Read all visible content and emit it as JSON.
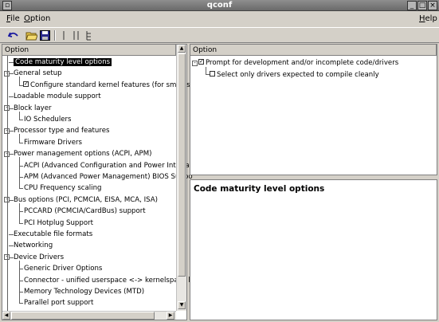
{
  "window": {
    "title": "qconf"
  },
  "menu": {
    "file": "ile",
    "file_u": "F",
    "option": "ption",
    "option_u": "O",
    "help": "elp",
    "help_u": "H"
  },
  "toolbar": {
    "tools": [
      {
        "icon": "undo-icon"
      },
      {
        "icon": "open-folder-icon"
      },
      {
        "icon": "save-icon"
      },
      {
        "icon": "single-view-icon"
      },
      {
        "icon": "split-view-icon"
      },
      {
        "icon": "full-view-icon"
      }
    ]
  },
  "left_panel": {
    "header": "Option",
    "items": [
      {
        "label": "Code maturity level options",
        "selected": true
      },
      {
        "label": "General setup",
        "expander": "-"
      },
      {
        "label": "Configure standard kernel features (for small sys",
        "checkbox": true
      },
      {
        "label": "Loadable module support"
      },
      {
        "label": "Block layer",
        "expander": "-"
      },
      {
        "label": "IO Schedulers"
      },
      {
        "label": "Processor type and features",
        "expander": "-"
      },
      {
        "label": "Firmware Drivers"
      },
      {
        "label": "Power management options (ACPI, APM)",
        "expander": "-"
      },
      {
        "label": "ACPI (Advanced Configuration and Power Interface"
      },
      {
        "label": "APM (Advanced Power Management) BIOS Suppo"
      },
      {
        "label": "CPU Frequency scaling"
      },
      {
        "label": "Bus options (PCI, PCMCIA, EISA, MCA, ISA)",
        "expander": "-"
      },
      {
        "label": "PCCARD (PCMCIA/CardBus) support"
      },
      {
        "label": "PCI Hotplug Support"
      },
      {
        "label": "Executable file formats"
      },
      {
        "label": "Networking"
      },
      {
        "label": "Device Drivers",
        "expander": "-"
      },
      {
        "label": "Generic Driver Options"
      },
      {
        "label": "Connector - unified userspace <-> kernelspace link"
      },
      {
        "label": "Memory Technology Devices (MTD)"
      },
      {
        "label": "Parallel port support"
      }
    ]
  },
  "right_panel": {
    "header": "Option",
    "items": [
      {
        "label": "Prompt for development and/or incomplete code/drivers",
        "checked": true
      },
      {
        "label": "Select only drivers expected to compile cleanly",
        "checked": false
      }
    ]
  },
  "help_panel": {
    "title": "Code maturity level options"
  }
}
